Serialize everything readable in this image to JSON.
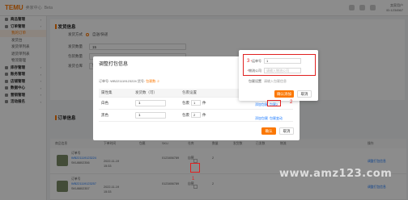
{
  "header": {
    "brand": "TEMU",
    "brand_sub": "卖家中心",
    "brand_tag": "Beta",
    "user_name": "卖家用户",
    "user_id": "ID:1234567"
  },
  "sidebar": {
    "items": [
      {
        "label": "商品管理",
        "type": "group"
      },
      {
        "label": "订单管理",
        "type": "group"
      },
      {
        "label": "我的订单",
        "type": "sub",
        "active": true
      },
      {
        "label": "发货台",
        "type": "sub"
      },
      {
        "label": "发货单列表",
        "type": "sub"
      },
      {
        "label": "退货单列表",
        "type": "sub"
      },
      {
        "label": "物流管理",
        "type": "sub"
      },
      {
        "label": "库存管理",
        "type": "group"
      },
      {
        "label": "账务管理",
        "type": "group"
      },
      {
        "label": "店铺管理",
        "type": "group"
      },
      {
        "label": "数据中心",
        "type": "group"
      },
      {
        "label": "营销管理",
        "type": "group"
      },
      {
        "label": "活动报名",
        "type": "group"
      }
    ]
  },
  "page": {
    "section_title": "发货信息",
    "delivery_label": "发货方式",
    "delivery_value": "自送/快递",
    "field1_label": "发货数量",
    "field1_value": "15",
    "field2_label": "包装数量",
    "field3_label": "发货仓库",
    "field3_value": "暂无仓库",
    "order_section_title": "订单信息"
  },
  "modal": {
    "title": "调整打包信息",
    "close": "×",
    "info_prefix": "订单号: ",
    "info_order": "WB221119123224",
    "info_mid": "  货号: ",
    "info_status_label": "包裹数:",
    "info_status_value": "2",
    "table": {
      "headers": [
        "属性集",
        "发货数（可）",
        "包裹设置",
        ""
      ],
      "rows": [
        {
          "attr": "白色",
          "qty": "1",
          "pkg_prefix": "包裹",
          "pkg_val": "1",
          "pkg_suffix": "件",
          "action": "添加包裹"
        },
        {
          "attr": "黑色",
          "qty": "1",
          "pkg_prefix": "包裹",
          "pkg_val": "2",
          "pkg_suffix": "件",
          "action": "添加包裹"
        }
      ]
    },
    "confirm": "确认",
    "cancel": "取消"
  },
  "popover": {
    "field1_label": "运单号",
    "field1_value": "1",
    "field2_label": "物流公司",
    "field2_placeholder": "请输入物流公司",
    "field3_label": "包裹设置",
    "field3_text": "请输入包裹信息",
    "confirm": "确认添加",
    "cancel": "取消",
    "side_link1": "添加包裹",
    "side_link2": "包裹2",
    "side_link3": "添加包裹",
    "side_link4": "包裹变动"
  },
  "annotations": [
    "1",
    "2",
    "3"
  ],
  "bg_table": {
    "headers": [
      "商品信息",
      "下单时间",
      "包裹",
      "SKU",
      "仓库",
      "数量",
      "发货数",
      "已发数",
      "物流",
      "操作"
    ],
    "rows": [
      {
        "title": "订单号",
        "id1": "WB221119123224",
        "id2": "SKU8802356",
        "date": "2022-11-19",
        "time": "15:33",
        "sku": "0123456789",
        "wh": "自营",
        "qty": "2",
        "link": "调整打包信息"
      },
      {
        "title": "订单号",
        "id1": "WB221119123257",
        "id2": "SKU8802357",
        "date": "2022-11-19",
        "time": "15:33",
        "sku": "0123456789",
        "wh": "自营",
        "qty": "2",
        "link": "调整打包信息"
      }
    ]
  },
  "watermark": "www.amz123.com"
}
